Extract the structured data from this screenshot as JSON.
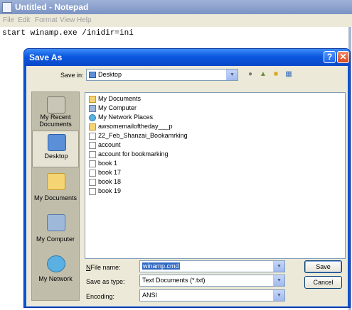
{
  "notepad": {
    "title": "Untitled - Notepad",
    "menu": [
      "File",
      "Edit",
      "Format",
      "View",
      "Help"
    ],
    "text": "start winamp.exe /inidir=ini"
  },
  "dialog": {
    "title": "Save As",
    "help_glyph": "?",
    "close_glyph": "✕",
    "save_in_label": "Save in:",
    "save_in_value": "Desktop",
    "places": [
      "My Recent Documents",
      "Desktop",
      "My Documents",
      "My Computer",
      "My Network"
    ],
    "files": [
      {
        "name": "My Documents",
        "icon": "mydocs"
      },
      {
        "name": "My Computer",
        "icon": "mycomp"
      },
      {
        "name": "My Network Places",
        "icon": "net"
      },
      {
        "name": "awsomemailoftheday___p",
        "icon": "fold"
      },
      {
        "name": "22_Feb_Shanzai_Bookamrking",
        "icon": "file"
      },
      {
        "name": "account",
        "icon": "file"
      },
      {
        "name": "account for bookmarking",
        "icon": "file"
      },
      {
        "name": "book 1",
        "icon": "file"
      },
      {
        "name": "book 17",
        "icon": "file"
      },
      {
        "name": "book 18",
        "icon": "file"
      },
      {
        "name": "book 19",
        "icon": "file"
      }
    ],
    "file_name_label": "File name:",
    "file_name_value": "winamp.cmd",
    "save_as_type_label": "Save as type:",
    "save_as_type_value": "Text Documents (*.txt)",
    "encoding_label": "Encoding:",
    "encoding_value": "ANSI",
    "save_button": "Save",
    "cancel_button": "Cancel"
  }
}
